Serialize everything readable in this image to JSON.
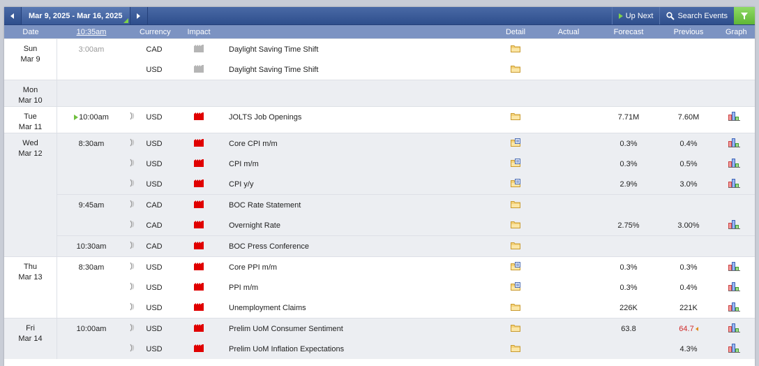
{
  "toolbar": {
    "date_range": "Mar 9, 2025 - Mar 16, 2025",
    "up_next": "Up Next",
    "search_events": "Search Events"
  },
  "columns": {
    "date": "Date",
    "time": "10:35am",
    "currency": "Currency",
    "impact": "Impact",
    "detail": "Detail",
    "actual": "Actual",
    "forecast": "Forecast",
    "previous": "Previous",
    "graph": "Graph"
  },
  "colors": {
    "header_bar": "#2e4e8c",
    "column_header": "#7c93c2",
    "high_impact": "#e00000",
    "holiday_impact": "#b5b5b5",
    "revised_previous": "#d02a2a"
  },
  "days": [
    {
      "weekday": "Sun",
      "date": "Mar 9",
      "events": [
        {
          "time": "3:00am",
          "currency": "CAD",
          "impact": "holiday",
          "event": "Daylight Saving Time Shift",
          "actual": "",
          "forecast": "",
          "previous": "",
          "graph": false,
          "alert": false
        },
        {
          "time": "",
          "currency": "USD",
          "impact": "holiday",
          "event": "Daylight Saving Time Shift",
          "actual": "",
          "forecast": "",
          "previous": "",
          "graph": false,
          "alert": false
        }
      ]
    },
    {
      "weekday": "Mon",
      "date": "Mar 10",
      "events": []
    },
    {
      "weekday": "Tue",
      "date": "Mar 11",
      "events": [
        {
          "time": "10:00am",
          "currency": "USD",
          "impact": "high",
          "event": "JOLTS Job Openings",
          "actual": "",
          "forecast": "7.71M",
          "previous": "7.60M",
          "graph": true,
          "alert": true,
          "next": true
        }
      ]
    },
    {
      "weekday": "Wed",
      "date": "Mar 12",
      "events": [
        {
          "time": "8:30am",
          "currency": "USD",
          "impact": "high",
          "event": "Core CPI m/m",
          "actual": "",
          "forecast": "0.3%",
          "previous": "0.4%",
          "graph": true,
          "alert": true,
          "doc": true
        },
        {
          "time": "",
          "currency": "USD",
          "impact": "high",
          "event": "CPI m/m",
          "actual": "",
          "forecast": "0.3%",
          "previous": "0.5%",
          "graph": true,
          "alert": true,
          "doc": true
        },
        {
          "time": "",
          "currency": "USD",
          "impact": "high",
          "event": "CPI y/y",
          "actual": "",
          "forecast": "2.9%",
          "previous": "3.0%",
          "graph": true,
          "alert": true,
          "doc": true
        },
        {
          "time": "9:45am",
          "currency": "CAD",
          "impact": "high",
          "event": "BOC Rate Statement",
          "actual": "",
          "forecast": "",
          "previous": "",
          "graph": false,
          "alert": true,
          "group": true
        },
        {
          "time": "",
          "currency": "CAD",
          "impact": "high",
          "event": "Overnight Rate",
          "actual": "",
          "forecast": "2.75%",
          "previous": "3.00%",
          "graph": true,
          "alert": true
        },
        {
          "time": "10:30am",
          "currency": "CAD",
          "impact": "high",
          "event": "BOC Press Conference",
          "actual": "",
          "forecast": "",
          "previous": "",
          "graph": false,
          "alert": true,
          "group": true
        }
      ]
    },
    {
      "weekday": "Thu",
      "date": "Mar 13",
      "events": [
        {
          "time": "8:30am",
          "currency": "USD",
          "impact": "high",
          "event": "Core PPI m/m",
          "actual": "",
          "forecast": "0.3%",
          "previous": "0.3%",
          "graph": true,
          "alert": true,
          "doc": true
        },
        {
          "time": "",
          "currency": "USD",
          "impact": "high",
          "event": "PPI m/m",
          "actual": "",
          "forecast": "0.3%",
          "previous": "0.4%",
          "graph": true,
          "alert": true,
          "doc": true
        },
        {
          "time": "",
          "currency": "USD",
          "impact": "high",
          "event": "Unemployment Claims",
          "actual": "",
          "forecast": "226K",
          "previous": "221K",
          "graph": true,
          "alert": true
        }
      ]
    },
    {
      "weekday": "Fri",
      "date": "Mar 14",
      "events": [
        {
          "time": "10:00am",
          "currency": "USD",
          "impact": "high",
          "event": "Prelim UoM Consumer Sentiment",
          "actual": "",
          "forecast": "63.8",
          "previous": "64.7",
          "previous_revised": true,
          "graph": true,
          "alert": true
        },
        {
          "time": "",
          "currency": "USD",
          "impact": "high",
          "event": "Prelim UoM Inflation Expectations",
          "actual": "",
          "forecast": "",
          "previous": "4.3%",
          "graph": true,
          "alert": true
        }
      ]
    }
  ]
}
